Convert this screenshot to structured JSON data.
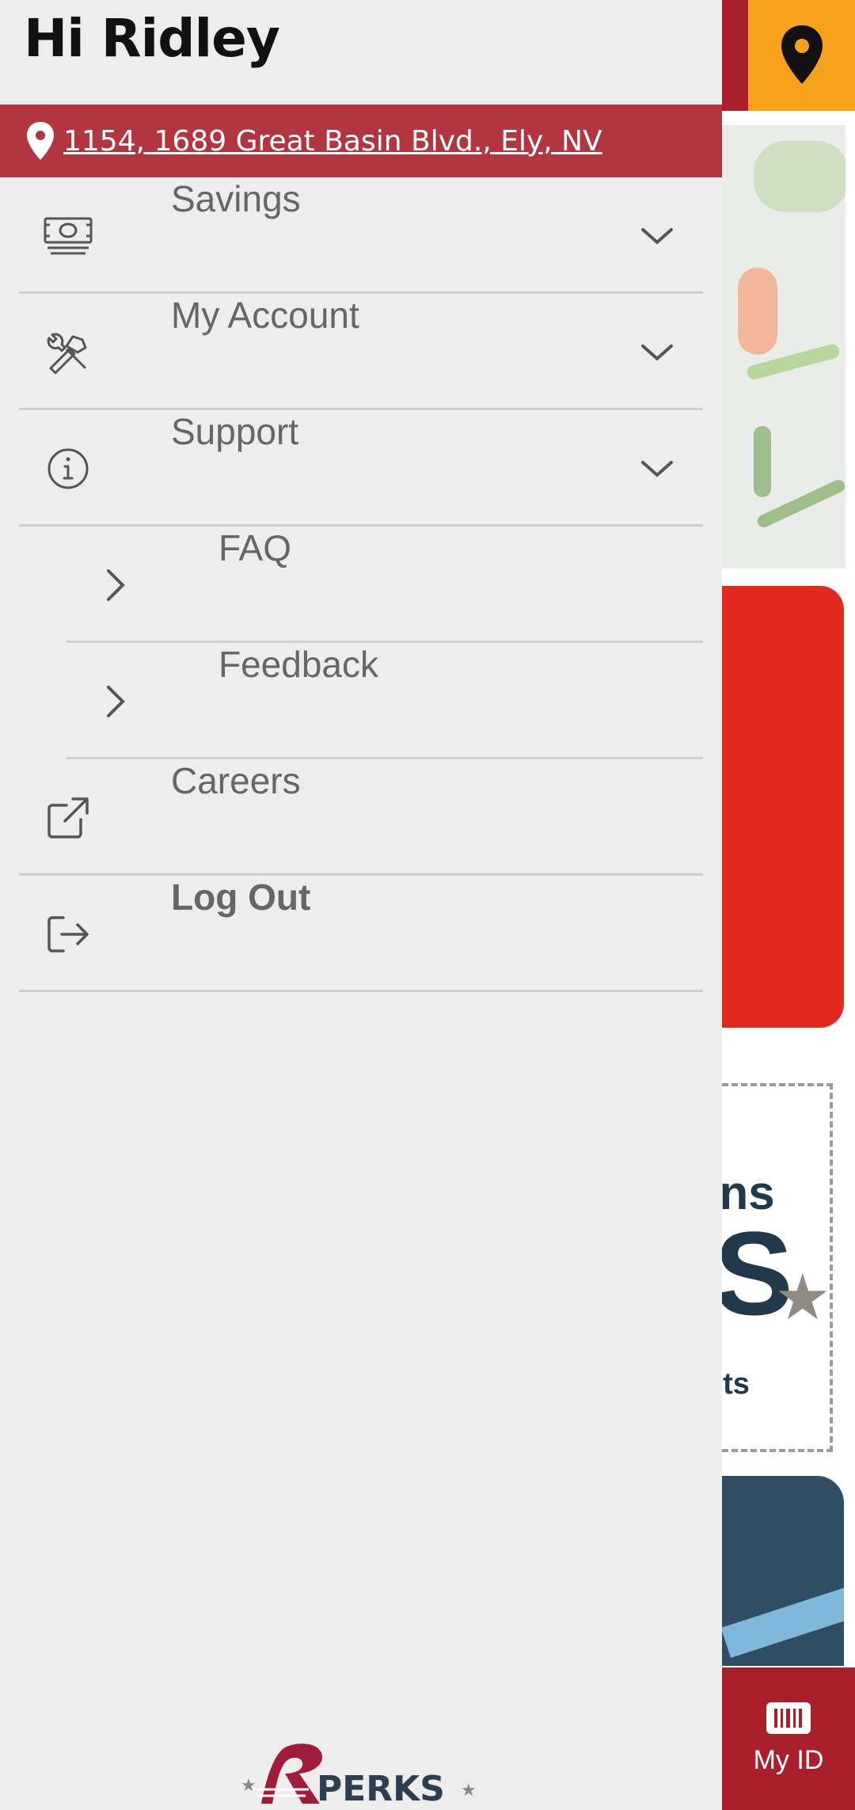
{
  "drawer": {
    "greeting": "Hi Ridley",
    "address": "1154, 1689 Great Basin Blvd., Ely, NV",
    "menu": [
      {
        "label": "Savings",
        "icon": "money-icon",
        "expandable": true
      },
      {
        "label": "My Account",
        "icon": "tools-icon",
        "expandable": true
      },
      {
        "label": "Support",
        "icon": "info-icon",
        "expandable": true,
        "expanded": true,
        "children": [
          {
            "label": "FAQ"
          },
          {
            "label": "Feedback"
          }
        ]
      },
      {
        "label": "Careers",
        "icon": "external-link-icon",
        "expandable": false
      },
      {
        "label": "Log Out",
        "icon": "logout-icon",
        "expandable": false
      }
    ],
    "logo_text": "PERKS"
  },
  "background": {
    "coupon_text_1": "ons",
    "coupon_text_2": "S",
    "coupon_text_3": "ets",
    "my_id_label": "My ID"
  },
  "colors": {
    "brand_red": "#a91f2a",
    "address_bar": "#b23640",
    "accent_orange": "#f7a21b",
    "drawer_bg": "#ededed",
    "promo_red": "#e1291f"
  }
}
